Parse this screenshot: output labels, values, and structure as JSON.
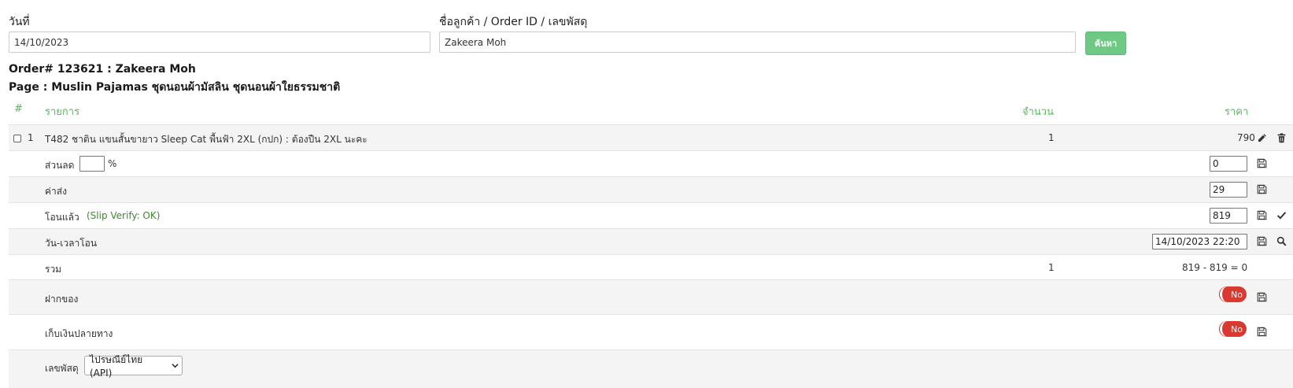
{
  "filters": {
    "date_label": "วันที่",
    "date_value": "14/10/2023",
    "search_label": "ชื่อลูกค้า / Order ID / เลขพัสดุ",
    "search_value": "Zakeera Moh",
    "search_button": "ค้นหา"
  },
  "order": {
    "title": "Order# 123621 : Zakeera Moh",
    "page": "Page : Muslin Pajamas ชุดนอนผ้ามัสลิน ชุดนอนผ้าใยธรรมชาติ"
  },
  "table": {
    "headers": {
      "num": "#",
      "item": "รายการ",
      "qty": "จำนวน",
      "price": "ราคา"
    },
    "item": {
      "index": "1",
      "name": "T482 ชาติน แขนสั้นขายาว Sleep Cat พื้นฟ้า 2XL (กปก) : ต้องปืน 2XL นะคะ",
      "qty": "1",
      "price": "790"
    },
    "discount": {
      "label": "ส่วนลด",
      "percent_value": "",
      "percent_sign": "%",
      "value": "0"
    },
    "shipping": {
      "label": "ค่าส่ง",
      "value": "29"
    },
    "transfer": {
      "label": "โอนแล้ว",
      "verify": "(Slip Verify: OK)",
      "value": "819"
    },
    "transfer_time": {
      "label": "วัน-เวลาโอน",
      "value": "14/10/2023 22:20"
    },
    "total": {
      "label": "รวม",
      "qty": "1",
      "value": "819 - 819 = 0"
    },
    "deposit": {
      "label": "ฝากของ",
      "toggle": "No"
    },
    "cod": {
      "label": "เก็บเงินปลายทาง",
      "toggle": "No"
    },
    "tracking": {
      "label": "เลขพัสดุ",
      "carrier": "ไปรษณีย์ไทย (API)"
    }
  },
  "colors": {
    "accent_green": "#5cb85c",
    "button_green": "#6dc983",
    "toggle_red": "#d9392f",
    "verify_green": "#3c8a2e"
  }
}
